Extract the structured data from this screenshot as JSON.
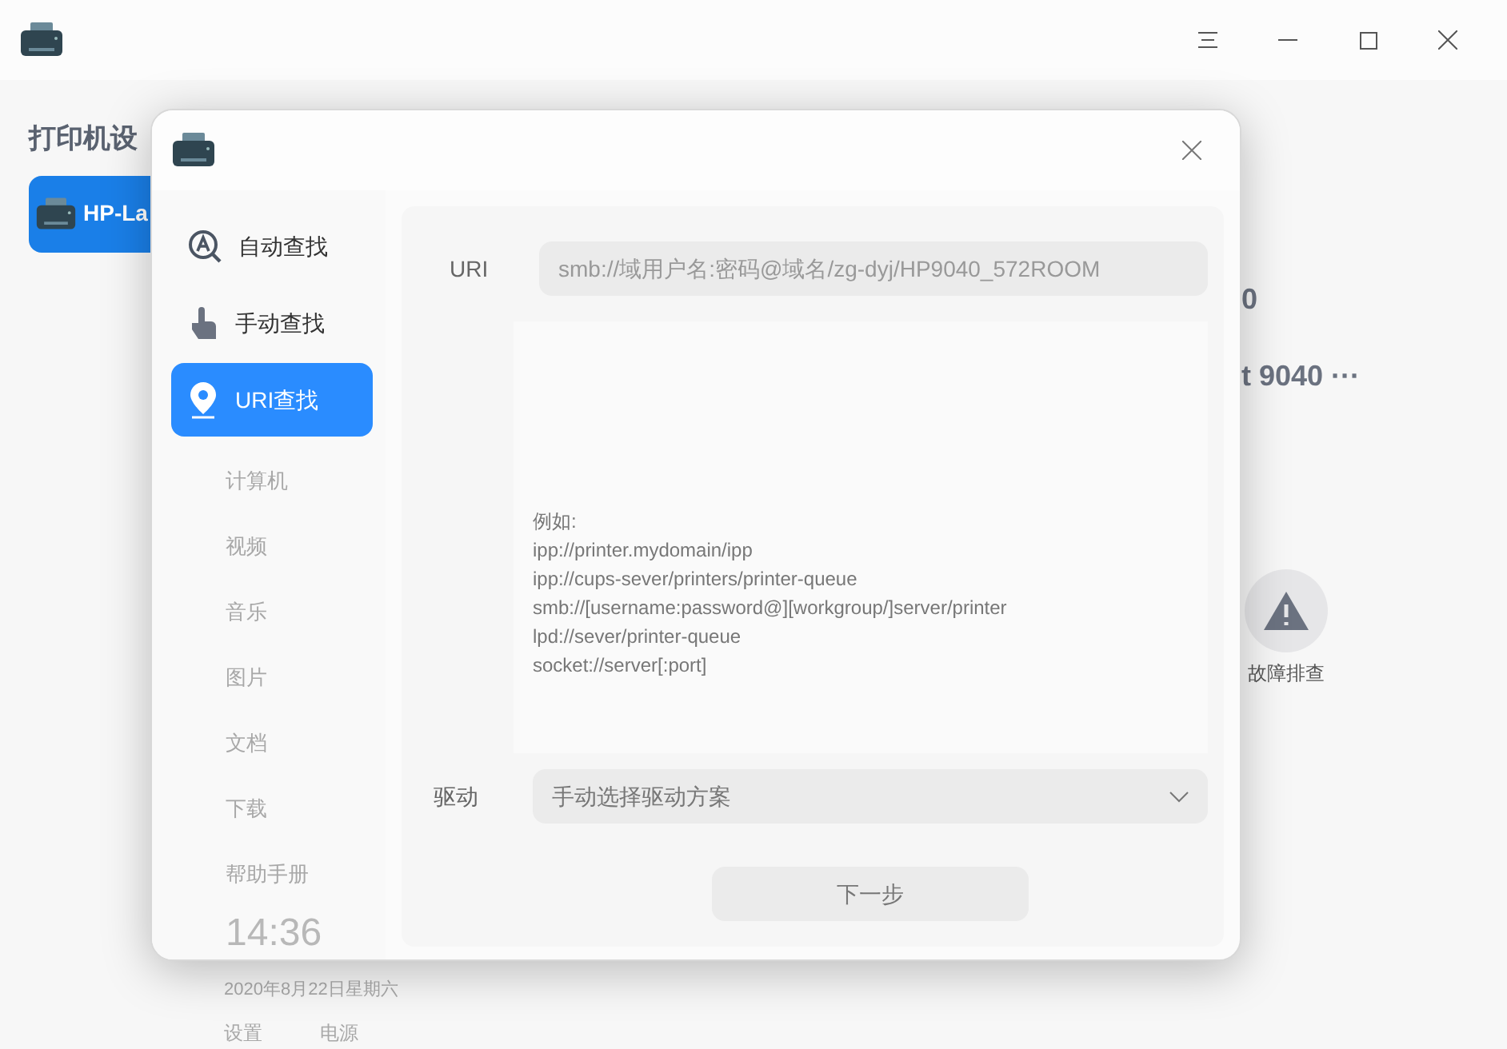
{
  "main_window": {
    "sidebar_title": "打印机设",
    "printers": [
      {
        "name": "HP-La",
        "selected": true
      }
    ],
    "detail_lines": [
      "0",
      "t 9040 ···"
    ],
    "troubleshoot": {
      "label": "故障排查"
    },
    "background_date": "2020年8月22日星期六",
    "background_actions": [
      "设置",
      "电源"
    ]
  },
  "dialog": {
    "nav": [
      {
        "label": "自动查找",
        "kind": "auto",
        "selected": false
      },
      {
        "label": "手动查找",
        "kind": "manual",
        "selected": false
      },
      {
        "label": "URI查找",
        "kind": "uri",
        "selected": true
      }
    ],
    "background_items": [
      "计算机",
      "视频",
      "音乐",
      "图片",
      "文档",
      "下载",
      "帮助手册"
    ],
    "background_clock": "14:36",
    "uri_label": "URI",
    "uri_placeholder": "smb://域用户名:密码@域名/zg-dyj/HP9040_572ROOM",
    "examples": [
      "例如:",
      "ipp://printer.mydomain/ipp",
      "ipp://cups-sever/printers/printer-queue",
      "smb://[username:password@][workgroup/]server/printer",
      "lpd://sever/printer-queue",
      "socket://server[:port]"
    ],
    "driver_label": "驱动",
    "driver_value": "手动选择驱动方案",
    "next_button": "下一步"
  }
}
